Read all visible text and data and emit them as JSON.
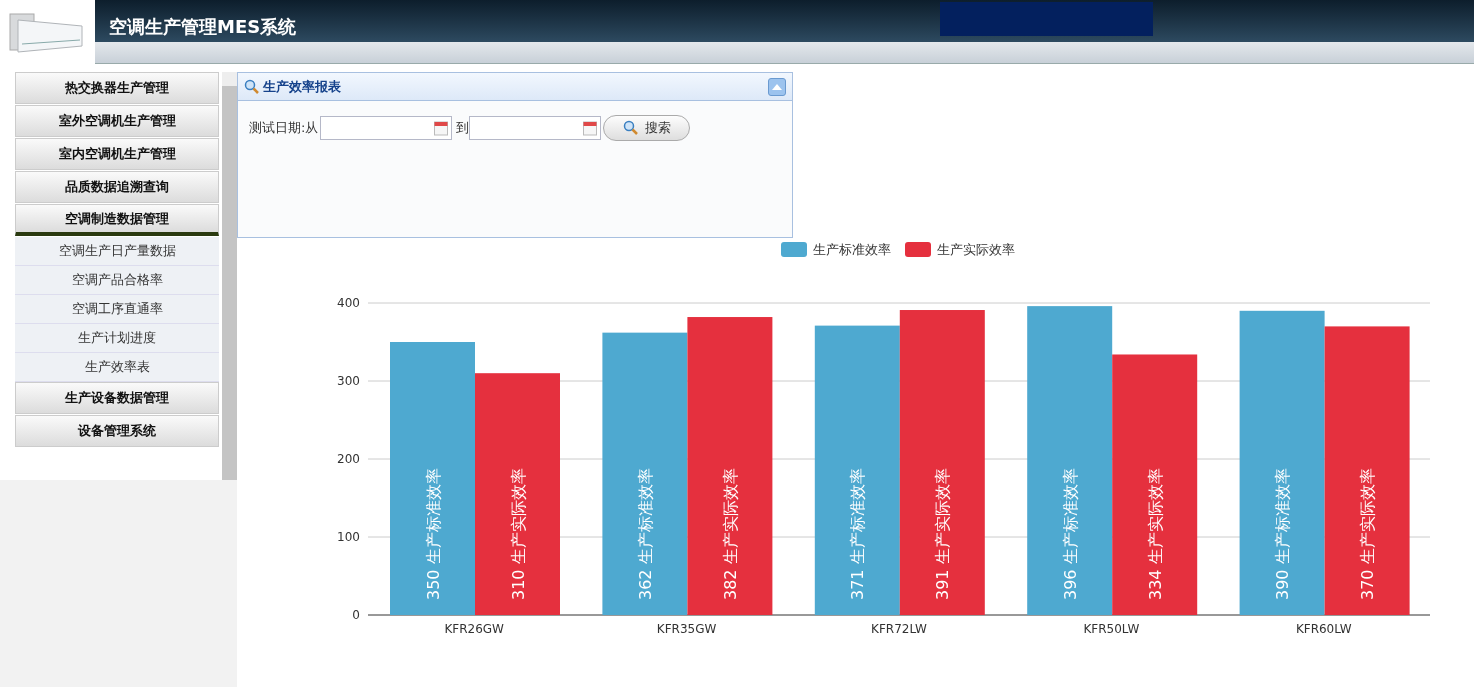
{
  "header": {
    "title": "空调生产管理MES系统"
  },
  "sidebar": {
    "groups": [
      {
        "label": "热交换器生产管理",
        "expanded": false
      },
      {
        "label": "室外空调机生产管理",
        "expanded": false
      },
      {
        "label": "室内空调机生产管理",
        "expanded": false
      },
      {
        "label": "品质数据追溯查询",
        "expanded": false
      },
      {
        "label": "空调制造数据管理",
        "expanded": true,
        "children": [
          {
            "label": "空调生产日产量数据"
          },
          {
            "label": "空调产品合格率"
          },
          {
            "label": "空调工序直通率"
          },
          {
            "label": "生产计划进度"
          },
          {
            "label": "生产效率表"
          }
        ]
      },
      {
        "label": "生产设备数据管理",
        "expanded": false
      },
      {
        "label": "设备管理系统",
        "expanded": false
      }
    ]
  },
  "panel": {
    "title": "生产效率报表",
    "date_label": "测试日期:从",
    "to_label": "到",
    "search_button": "搜索"
  },
  "chart_data": {
    "type": "bar",
    "categories": [
      "KFR26GW",
      "KFR35GW",
      "KFR72LW",
      "KFR50LW",
      "KFR60LW"
    ],
    "series": [
      {
        "name": "生产标准效率",
        "color": "#4ea9d0",
        "values": [
          350,
          362,
          371,
          396,
          390
        ]
      },
      {
        "name": "生产实际效率",
        "color": "#e5303e",
        "values": [
          310,
          382,
          391,
          334,
          370
        ]
      }
    ],
    "ylim": [
      0,
      400
    ],
    "yticks": [
      0,
      100,
      200,
      300,
      400
    ],
    "data_labels": true,
    "grid": true,
    "legend": true
  }
}
